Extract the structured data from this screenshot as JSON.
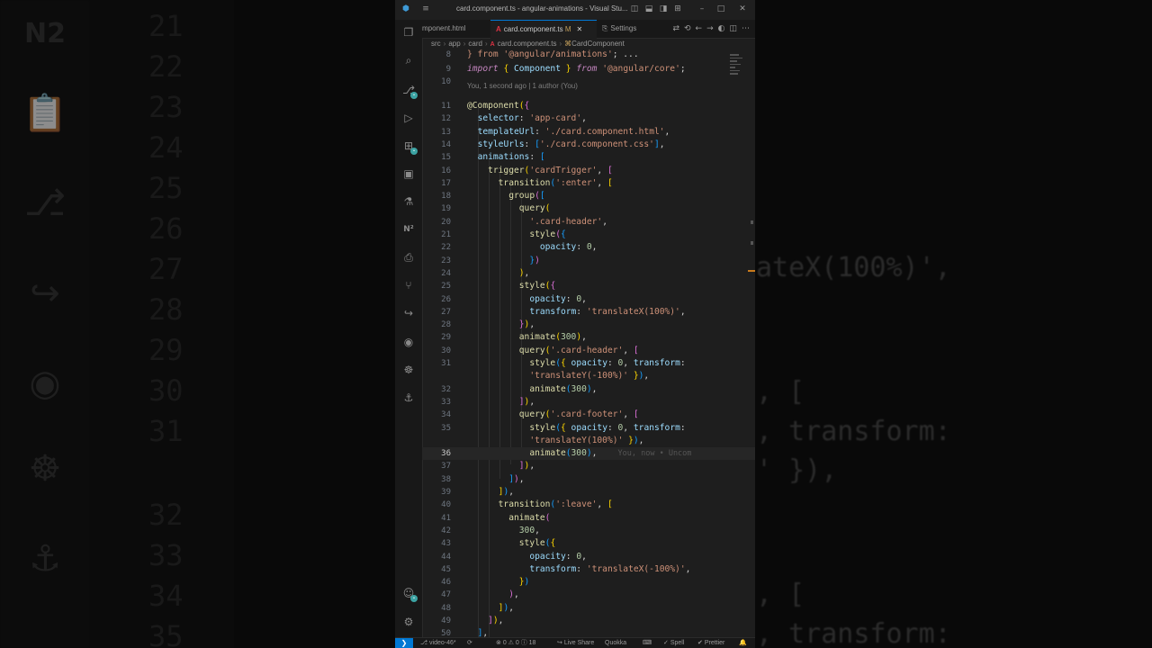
{
  "window": {
    "title": "card.component.ts - angular-animations - Visual Stu..."
  },
  "tabs": [
    {
      "label": "mponent.html"
    },
    {
      "label": "card.component.ts",
      "badge": "M"
    },
    {
      "label": "Settings"
    }
  ],
  "breadcrumb": [
    "src",
    "app",
    "card",
    "card.component.ts",
    "CardComponent"
  ],
  "blame": "You, 1 second ago | 1 author (You)",
  "ghost_text": "You, now • Uncom",
  "line_numbers": [
    "8",
    "9",
    "10",
    "11",
    "12",
    "13",
    "14",
    "15",
    "16",
    "17",
    "18",
    "19",
    "20",
    "21",
    "22",
    "23",
    "24",
    "25",
    "26",
    "27",
    "28",
    "29",
    "30",
    "31",
    "",
    "32",
    "33",
    "34",
    "35",
    "",
    "36",
    "37",
    "38",
    "39",
    "40",
    "41",
    "42",
    "43",
    "44",
    "45",
    "46",
    "47",
    "48",
    "49",
    "50"
  ],
  "status": {
    "branch": "video-46*",
    "problems": "0 ⚠ 0 ⓘ 18",
    "live_share": "Live Share",
    "quokka": "Quokka",
    "spell": "Spell",
    "prettier": "Prettier"
  },
  "background_line_numbers": [
    "21",
    "22",
    "23",
    "24",
    "25",
    "26",
    "27",
    "28",
    "29",
    "30",
    "31",
    "32",
    "33",
    "34",
    "35"
  ],
  "background_code": [
    "ateX(100%)',",
    ", [",
    ", transform:",
    "' }),",
    ", [",
    ", transform:"
  ],
  "background_logo": "N2"
}
